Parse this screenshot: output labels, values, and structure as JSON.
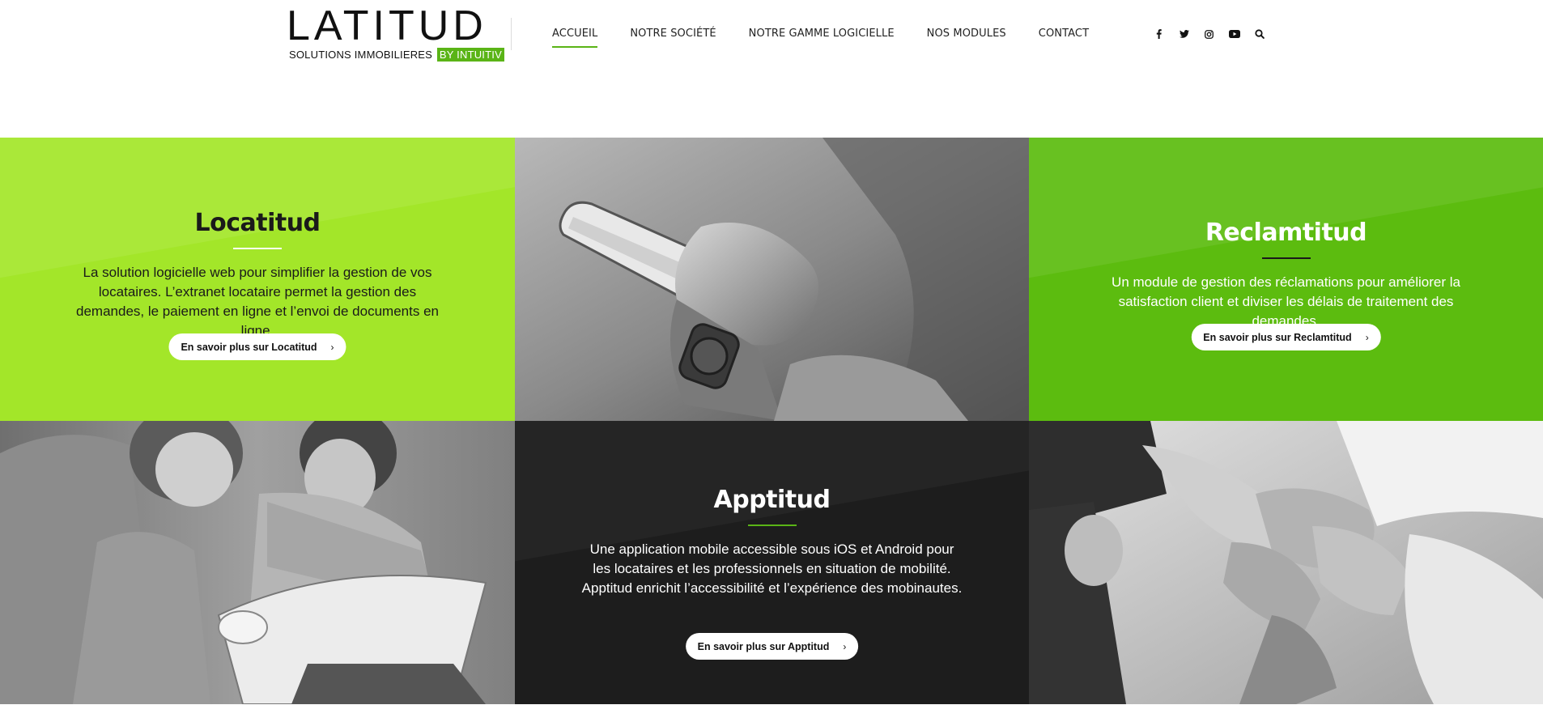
{
  "brand": {
    "logo_word": "LATITUD",
    "tagline": "SOLUTIONS IMMOBILIERES",
    "tagline_badge": "BY INTUITIV",
    "accent_color": "#5ab416"
  },
  "nav": {
    "items": [
      {
        "label": "ACCUEIL",
        "active": true
      },
      {
        "label": "NOTRE SOCIÉTÉ",
        "active": false
      },
      {
        "label": "NOTRE GAMME LOGICIELLE",
        "active": false
      },
      {
        "label": "NOS MODULES",
        "active": false
      },
      {
        "label": "CONTACT",
        "active": false
      }
    ]
  },
  "social": {
    "icons": [
      "facebook-icon",
      "twitter-icon",
      "instagram-icon",
      "youtube-icon",
      "search-icon"
    ]
  },
  "panels": {
    "locatitud": {
      "title": "Locatitud",
      "text": "La solution logicielle web pour simplifier la gestion de vos locataires. L’extranet locataire permet la gestion des demandes, le paiement en ligne et l’envoi de documents en ligne.",
      "button": "En savoir plus sur Locatitud",
      "bg": "#a3e629"
    },
    "reclamtitud": {
      "title": "Reclamtitud",
      "text": "Un module de gestion des réclamations pour améliorer la satisfaction client et diviser les délais de traitement des demandes.",
      "button": "En savoir plus sur Reclamtitud",
      "bg": "#5cbc0f"
    },
    "apptitud": {
      "title": "Apptitud",
      "text": "Une application mobile accessible sous iOS et Android pour les locataires et les professionnels en situation de mobilité. Apptitud enrichit l’accessibilité et l’expérience des mobinautes.",
      "button": "En savoir plus sur Apptitud",
      "bg": "#1d1d1d"
    }
  },
  "button_chevron": "›"
}
